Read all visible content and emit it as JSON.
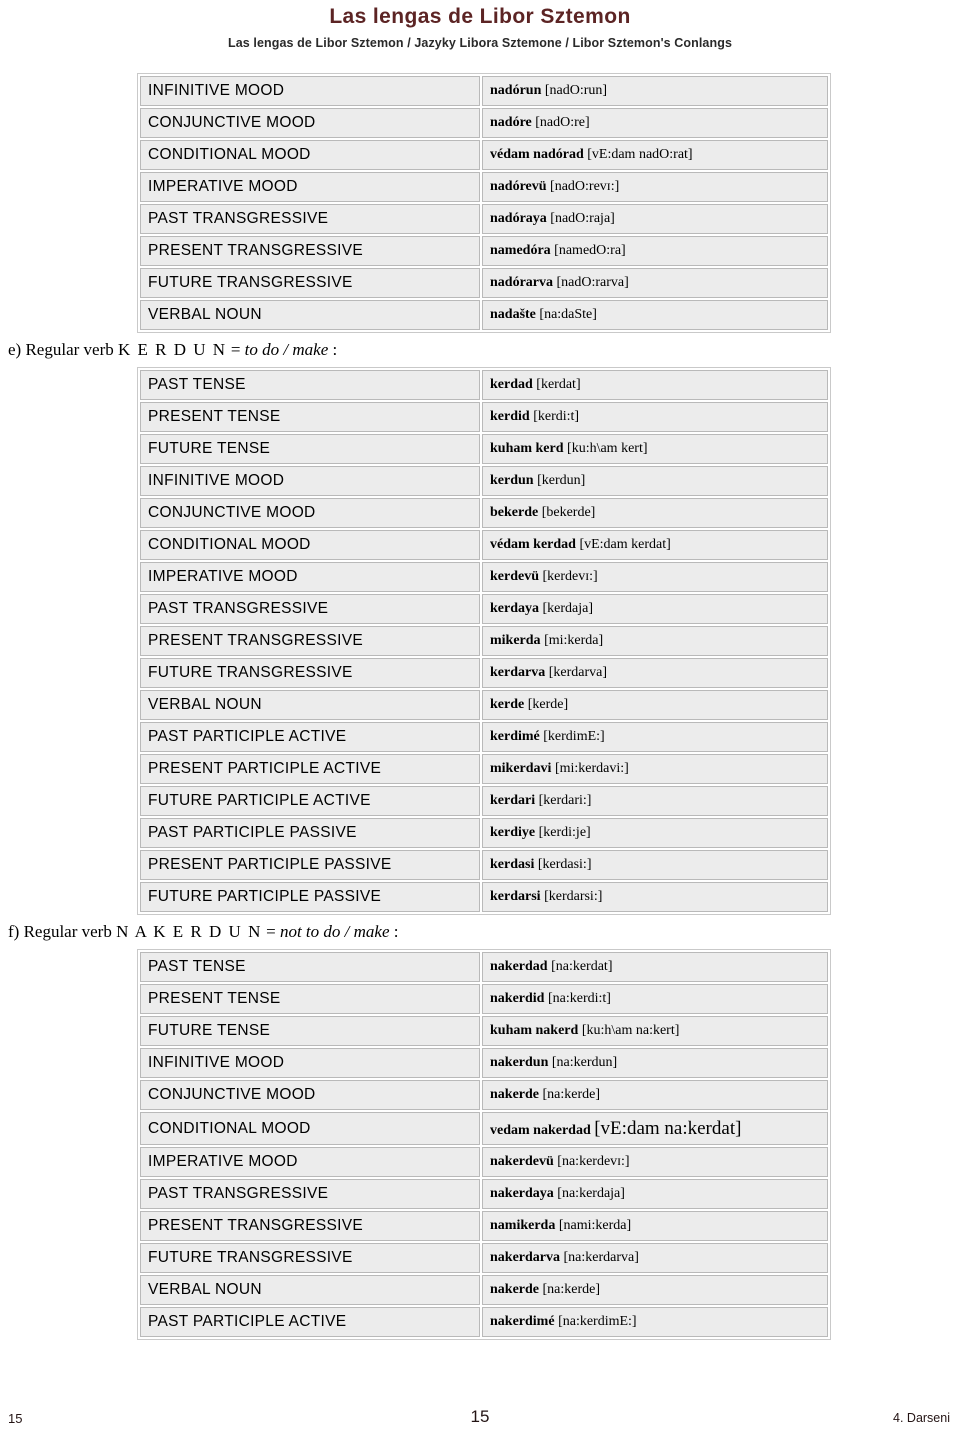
{
  "header": {
    "title": "Las lengas de Libor Sztemon",
    "subtitle": "Las lengas de Libor Sztemon / Jazyky Libora Sztemone / Libor Sztemon's Conlangs",
    "title_color": "#5c2424"
  },
  "sections": [
    {
      "heading": null,
      "rows": [
        {
          "label": "INFINITIVE MOOD",
          "word": "nadórun",
          "ipa": "[nadO:run]"
        },
        {
          "label": "CONJUNCTIVE MOOD",
          "word": "nadóre",
          "ipa": "[nadO:re]"
        },
        {
          "label": "CONDITIONAL MOOD",
          "word": "védam nadórad",
          "ipa": "[vE:dam nadO:rat]"
        },
        {
          "label": "IMPERATIVE MOOD",
          "word": "nadórevü",
          "ipa": "[nadO:revɪ:]"
        },
        {
          "label": "PAST TRANSGRESSIVE",
          "word": "nadóraya",
          "ipa": "[nadO:raja]"
        },
        {
          "label": "PRESENT TRANSGRESSIVE",
          "word": "namedóra",
          "ipa": "[namedO:ra]"
        },
        {
          "label": "FUTURE TRANSGRESSIVE",
          "word": "nadórarva",
          "ipa": "[nadO:rarva]"
        },
        {
          "label": "VERBAL NOUN",
          "word": "nadašte",
          "ipa": "[na:daSte]"
        }
      ]
    },
    {
      "heading": {
        "prefix": "e) Regular verb ",
        "verb": "K E R D U N",
        "equals": " = ",
        "gloss": "to do / make",
        "suffix": " :"
      },
      "rows": [
        {
          "label": "PAST TENSE",
          "word": "kerdad",
          "ipa": "[kerdat]"
        },
        {
          "label": "PRESENT TENSE",
          "word": "kerdid",
          "ipa": "[kerdi:t]"
        },
        {
          "label": "FUTURE TENSE",
          "word": "kuham kerd",
          "ipa": "[ku:h\\am kert]"
        },
        {
          "label": "INFINITIVE MOOD",
          "word": "kerdun",
          "ipa": "[kerdun]"
        },
        {
          "label": "CONJUNCTIVE MOOD",
          "word": "bekerde",
          "ipa": "[bekerde]"
        },
        {
          "label": "CONDITIONAL MOOD",
          "word": "védam kerdad",
          "ipa": "[vE:dam kerdat]"
        },
        {
          "label": "IMPERATIVE MOOD",
          "word": "kerdevü",
          "ipa": "[kerdevɪ:]"
        },
        {
          "label": "PAST TRANSGRESSIVE",
          "word": "kerdaya",
          "ipa": "[kerdaja]"
        },
        {
          "label": "PRESENT TRANSGRESSIVE",
          "word": "mikerda",
          "ipa": "[mi:kerda]"
        },
        {
          "label": "FUTURE TRANSGRESSIVE",
          "word": "kerdarva",
          "ipa": "[kerdarva]"
        },
        {
          "label": "VERBAL NOUN",
          "word": "kerde",
          "ipa": "[kerde]"
        },
        {
          "label": "PAST PARTICIPLE ACTIVE",
          "word": "kerdimé",
          "ipa": "[kerdimE:]"
        },
        {
          "label": "PRESENT PARTICIPLE ACTIVE",
          "word": "mikerdavi",
          "ipa": "[mi:kerdavi:]"
        },
        {
          "label": "FUTURE PARTICIPLE ACTIVE",
          "word": "kerdari",
          "ipa": "[kerdari:]"
        },
        {
          "label": "PAST PARTICIPLE PASSIVE",
          "word": "kerdiye",
          "ipa": "[kerdi:je]"
        },
        {
          "label": "PRESENT PARTICIPLE PASSIVE",
          "word": "kerdasi",
          "ipa": "[kerdasi:]"
        },
        {
          "label": "FUTURE PARTICIPLE PASSIVE",
          "word": "kerdarsi",
          "ipa": "[kerdarsi:]"
        }
      ]
    },
    {
      "heading": {
        "prefix": "f) Regular verb ",
        "verb": "N A K E R D U N",
        "equals": " = ",
        "gloss": "not to do / make",
        "suffix": " :"
      },
      "rows": [
        {
          "label": "PAST TENSE",
          "word": "nakerdad",
          "ipa": "[na:kerdat]"
        },
        {
          "label": "PRESENT TENSE",
          "word": "nakerdid",
          "ipa": "[na:kerdi:t]"
        },
        {
          "label": "FUTURE TENSE",
          "word": "kuham nakerd",
          "ipa": "[ku:h\\am na:kert]"
        },
        {
          "label": "INFINITIVE MOOD",
          "word": "nakerdun",
          "ipa": "[na:kerdun]"
        },
        {
          "label": "CONJUNCTIVE MOOD",
          "word": "nakerde",
          "ipa": "[na:kerde]"
        },
        {
          "label": "CONDITIONAL MOOD",
          "word": "vedam nakerdad",
          "ipa": "[vE:dam na:kerdat]",
          "emphasis": true
        },
        {
          "label": "IMPERATIVE MOOD",
          "word": "nakerdevü",
          "ipa": "[na:kerdevɪ:]"
        },
        {
          "label": "PAST TRANSGRESSIVE",
          "word": "nakerdaya",
          "ipa": "[na:kerdaja]"
        },
        {
          "label": "PRESENT TRANSGRESSIVE",
          "word": "namikerda",
          "ipa": "[nami:kerda]"
        },
        {
          "label": "FUTURE TRANSGRESSIVE",
          "word": "nakerdarva",
          "ipa": "[na:kerdarva]"
        },
        {
          "label": "VERBAL NOUN",
          "word": "nakerde",
          "ipa": "[na:kerde]"
        },
        {
          "label": "PAST PARTICIPLE ACTIVE",
          "word": "nakerdimé",
          "ipa": "[na:kerdimE:]"
        }
      ]
    }
  ],
  "footer": {
    "left": "15",
    "center": "15",
    "right": "4. Darseni"
  }
}
